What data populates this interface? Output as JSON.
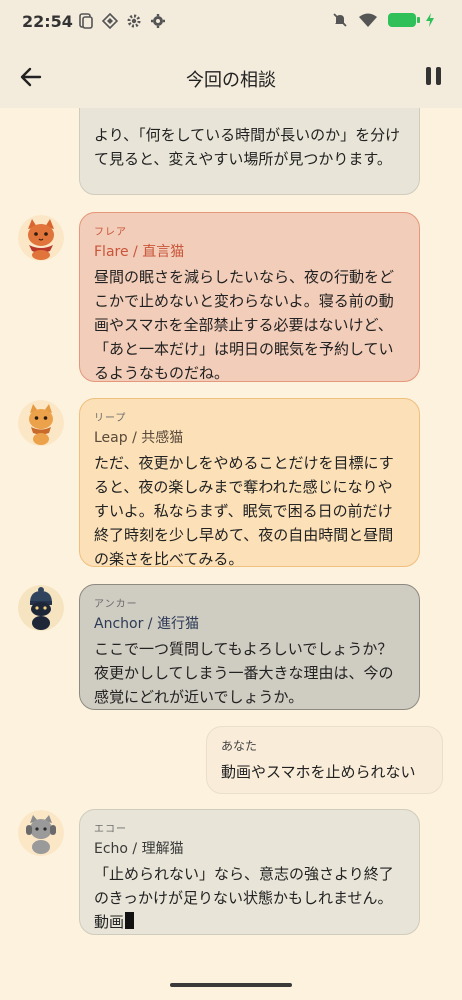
{
  "status_bar": {
    "time": "22:54"
  },
  "app_bar": {
    "title": "今回の相談"
  },
  "messages": [
    {
      "text": "より、「何をしている時間が長いのか」を分けて見ると、変えやすい場所が見つかります。"
    },
    {
      "sub": "フレア",
      "name": "Flare / 直言猫",
      "text": "昼間の眠さを減らしたいなら、夜の行動をどこかで止めないと変わらないよ。寝る前の動画やスマホを全部禁止する必要はないけど、「あと一本だけ」は明日の眠気を予約しているようなものだね。",
      "color": "#c9553a"
    },
    {
      "sub": "リープ",
      "name": "Leap / 共感猫",
      "text": "ただ、夜更かしをやめることだけを目標にすると、夜の楽しみまで奪われた感じになりやすいよ。私ならまず、眠気で困る日の前だけ終了時刻を少し早めて、夜の自由時間と昼間の楽さを比べてみる。",
      "color": "#5a4a3a"
    },
    {
      "sub": "アンカー",
      "name": "Anchor / 進行猫",
      "text": "ここで一つ質問してもよろしいでしょうか？ 夜更かししてしまう一番大きな理由は、今の感覚にどれが近いでしょうか。",
      "color": "#2c3a55"
    },
    {
      "sub": "あなた",
      "text": "動画やスマホを止められない"
    },
    {
      "sub": "エコー",
      "name": "Echo / 理解猫",
      "text": "「止められない」なら、意志の強さより終了のきっかけが足りない状態かもしれません。動画",
      "color": "#3a3a3a"
    }
  ],
  "colors": {
    "background": "#fdf2de",
    "flare_bubble": "#f2cdb9",
    "leap_bubble": "#fbe0b8",
    "anchor_bubble": "#cfccc2",
    "user_bubble": "#f9ecd9",
    "echo_bubble": "#e8e5d8"
  },
  "icons": [
    "back-arrow-icon",
    "pause-icon",
    "wifi-icon",
    "battery-icon",
    "mute-icon",
    "gear-icon"
  ]
}
